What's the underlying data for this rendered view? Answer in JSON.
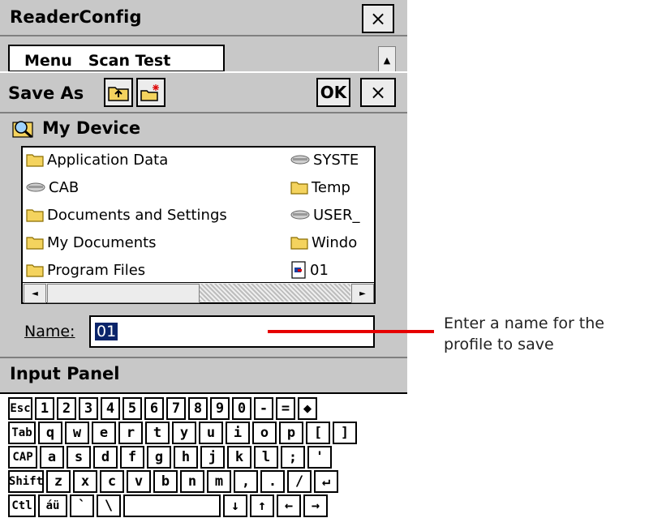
{
  "window": {
    "title": "ReaderConfig",
    "close_symbol": "×"
  },
  "tabs": {
    "label": "Menu   Scan Test",
    "scroll_up_symbol": "▲"
  },
  "dialog": {
    "title": "Save As",
    "ok_label": "OK",
    "close_symbol": "×",
    "location": "My Device",
    "files_left": [
      {
        "name": "Application Data",
        "icon": "folder-icon"
      },
      {
        "name": "CAB",
        "icon": "drive-icon"
      },
      {
        "name": "Documents and Settings",
        "icon": "folder-icon"
      },
      {
        "name": "My Documents",
        "icon": "folder-icon"
      },
      {
        "name": "Program Files",
        "icon": "folder-icon"
      }
    ],
    "files_right": [
      {
        "name": "SYSTE",
        "icon": "drive-icon"
      },
      {
        "name": "Temp",
        "icon": "folder-icon"
      },
      {
        "name": "USER_",
        "icon": "drive-icon"
      },
      {
        "name": "Windo",
        "icon": "folder-icon"
      },
      {
        "name": "01",
        "icon": "file-icon"
      }
    ],
    "scroll_left_symbol": "◄",
    "scroll_right_symbol": "►",
    "name_label": "Name:",
    "name_value": "01"
  },
  "input_panel": {
    "label": "Input Panel",
    "rows": [
      [
        "Esc",
        "1",
        "2",
        "3",
        "4",
        "5",
        "6",
        "7",
        "8",
        "9",
        "0",
        "-",
        "=",
        "◆"
      ],
      [
        "Tab",
        "q",
        "w",
        "e",
        "r",
        "t",
        "y",
        "u",
        "i",
        "o",
        "p",
        "[",
        "]"
      ],
      [
        "CAP",
        "a",
        "s",
        "d",
        "f",
        "g",
        "h",
        "j",
        "k",
        "l",
        ";",
        "'"
      ],
      [
        "Shift",
        "z",
        "x",
        "c",
        "v",
        "b",
        "n",
        "m",
        ",",
        ".",
        "/",
        "↵"
      ],
      [
        "Ctl",
        "áü",
        "`",
        "\\",
        " ",
        "↓",
        "↑",
        "←",
        "→"
      ]
    ]
  },
  "annotation": {
    "text": "Enter a name for the profile to save",
    "line_color": "#e60000"
  }
}
